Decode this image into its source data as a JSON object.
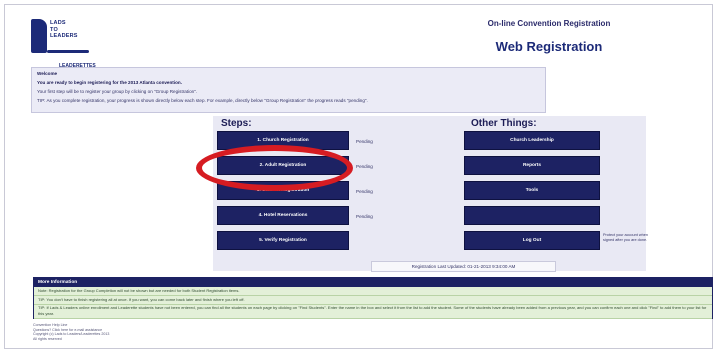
{
  "header": {
    "logo_lines": [
      "LADS",
      "TO",
      "LEADERS"
    ],
    "logo_sub": "LEADERETTES",
    "kicker": "On-line Convention Registration",
    "title": "Web Registration"
  },
  "welcome": {
    "heading": "Welcome",
    "line1": "You are ready to begin registering for the 2013 Atlanta convention.",
    "line2": "Your first step will be to register your group by clicking on \"Group Registration\".",
    "line3": "TIP: As you complete registration, your progress is shown directly below each step. For example, directly below \"Group Registration\" the progress reads \"pending\"."
  },
  "steps": {
    "title": "Steps:",
    "items": [
      {
        "label": "1. Church Registration",
        "status": "Pending"
      },
      {
        "label": "2. Adult Registration",
        "status": "Pending"
      },
      {
        "label": "3. Student Registration",
        "status": "Pending"
      },
      {
        "label": "4. Hotel Reservations",
        "status": "Pending"
      },
      {
        "label": "5. Verify Registration",
        "status": ""
      }
    ]
  },
  "other": {
    "title": "Other Things:",
    "items": [
      {
        "label": "Church Leadership"
      },
      {
        "label": "Reports"
      },
      {
        "label": "Tools"
      },
      {
        "label": ""
      },
      {
        "label": "Log Out"
      }
    ],
    "logout_note": "Protect your account when signed after you are done."
  },
  "updated": "Registration Last Updated: 01-21-2013 9:34:00 AM",
  "more_info": {
    "title": "More Information",
    "rows": [
      "Note: Registration for the Group Completion will not be shown but are needed for both Student Registration items.",
      "TIP: You don't have to finish registering all at once. If you want, you can come back later and finish where you left off.",
      "TIP: If Lads & Leaders online enrollment and Leaderette students have not been entered, you can find all the students on each page by clicking on \"Find Students\". Enter the name in the box and select it from the list to add the student. Some of the students have already been added from a previous year, and you can confirm each one and click \"Find\" to add them to your list for this year."
    ]
  },
  "footer": [
    "Convention Help Line",
    "Questions? Click here for e-mail assistance",
    "Copyright (c) Lads to Leaders/Leaderettes 2013",
    "All rights reserved"
  ],
  "colors": {
    "button": "#1d2263",
    "highlight": "#d61c22",
    "panel": "#e9e9f4"
  }
}
